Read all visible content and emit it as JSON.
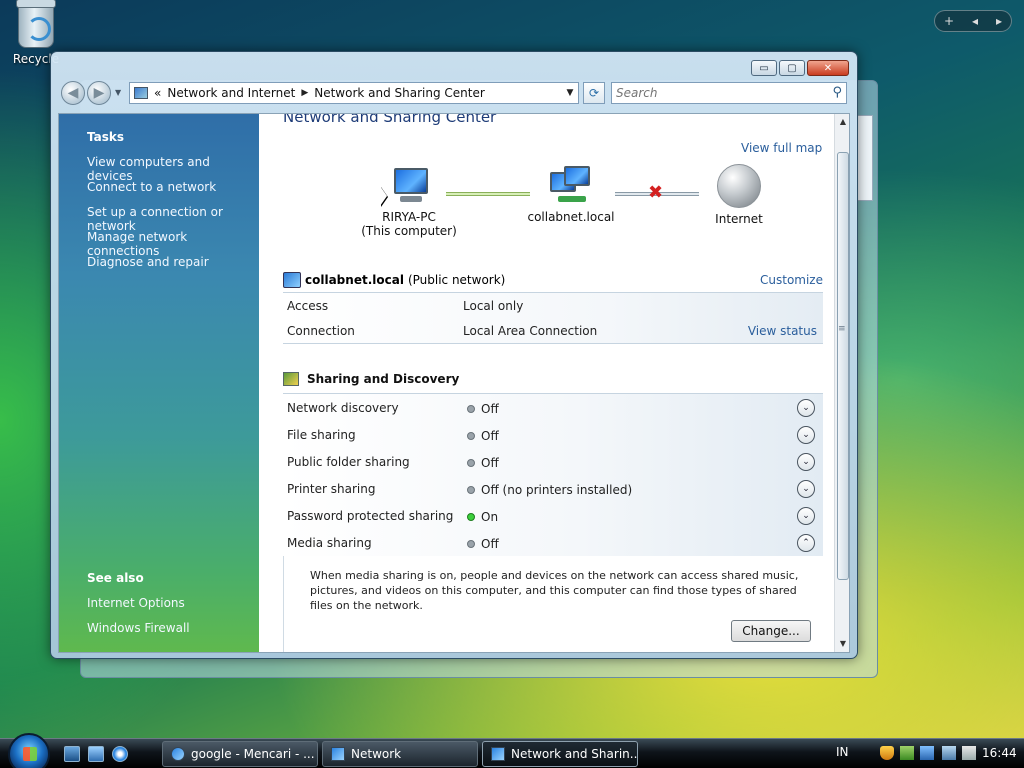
{
  "desktop": {
    "recycle_label": "Recycle"
  },
  "gadget": {
    "plus": "+",
    "prev": "◂",
    "next": "▸"
  },
  "window": {
    "caption": {
      "minimize": "▭",
      "maximize": "▢",
      "close": "✕"
    },
    "address": {
      "chevron": "«",
      "crumb1": "Network and Internet",
      "crumb2": "Network and Sharing Center",
      "sep": "▶",
      "dropdown": "▼"
    },
    "search_placeholder": "Search",
    "tasks": {
      "heading": "Tasks",
      "links": [
        "View computers and devices",
        "Connect to a network",
        "Set up a connection or network",
        "Manage network connections",
        "Diagnose and repair"
      ]
    },
    "see_also": {
      "heading": "See also",
      "links": [
        "Internet Options",
        "Windows Firewall"
      ]
    },
    "page_title": "Network and Sharing Center",
    "view_full_map": "View full map",
    "map": {
      "computer_name": "RIRYA-PC",
      "computer_sub": "(This computer)",
      "network_name": "collabnet.local",
      "internet_name": "Internet",
      "broken": "✖"
    },
    "network": {
      "name": "collabnet.local",
      "type": "(Public network)",
      "customize": "Customize",
      "access_label": "Access",
      "access_value": "Local only",
      "connection_label": "Connection",
      "connection_value": "Local Area Connection",
      "view_status": "View status"
    },
    "sharing": {
      "heading": "Sharing and Discovery",
      "rows": [
        {
          "label": "Network discovery",
          "status": "Off",
          "on": false
        },
        {
          "label": "File sharing",
          "status": "Off",
          "on": false
        },
        {
          "label": "Public folder sharing",
          "status": "Off",
          "on": false
        },
        {
          "label": "Printer sharing",
          "status": "Off (no printers installed)",
          "on": false
        },
        {
          "label": "Password protected sharing",
          "status": "On",
          "on": true
        },
        {
          "label": "Media sharing",
          "status": "Off",
          "on": false
        }
      ],
      "chev_down": "⌄",
      "chev_up": "⌃",
      "media_description": "When media sharing is on, people and devices on the network can access shared music, pictures, and videos on this computer, and this computer can find those types of shared files on the network.",
      "change_button": "Change..."
    }
  },
  "taskbar": {
    "buttons": [
      "google - Mencari - ...",
      "Network",
      "Network and Sharin..."
    ],
    "lang": "IN",
    "clock": "16:44"
  }
}
